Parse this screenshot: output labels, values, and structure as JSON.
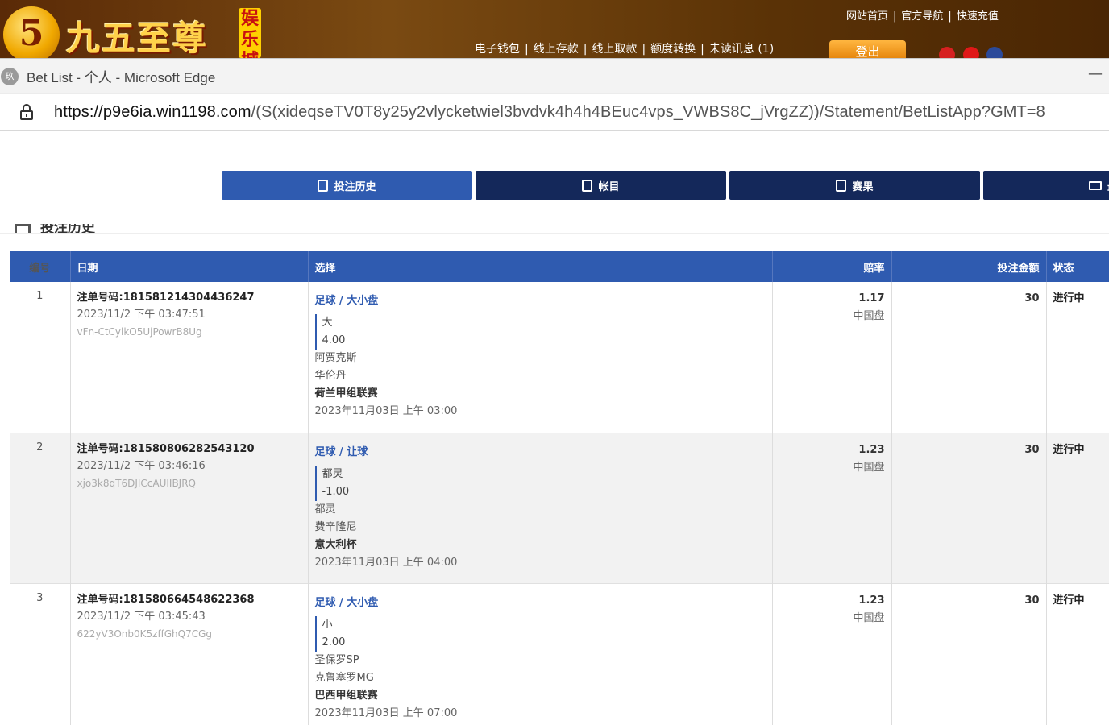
{
  "site": {
    "logo_mark": "5",
    "logo_text": "九五至尊",
    "logo_badge": "娱乐城",
    "top_links": [
      "网站首页",
      "官方导航",
      "快速充值"
    ],
    "nav_links": [
      "电子钱包",
      "线上存款",
      "线上取款",
      "额度转换",
      "未读讯息 (1)"
    ],
    "login_label": "登出"
  },
  "browser": {
    "title": "Bet List - 个人 - Microsoft Edge",
    "url_host": "https://p9e6ia.win1198.com",
    "url_path": "/(S(xideqseTV0T8y25y2vlycketwiel3bvdvk4h4h4BEuc4vps_VWBS8C_jVrgZZ))/Statement/BetListApp?GMT=8",
    "minimize_icon": "minimize-icon"
  },
  "tabs": [
    {
      "label": "投注历史",
      "icon": "receipt-icon",
      "active": true
    },
    {
      "label": "帐目",
      "icon": "ledger-icon",
      "active": false
    },
    {
      "label": "赛果",
      "icon": "results-icon",
      "active": false
    },
    {
      "label": "最新",
      "icon": "envelope-icon",
      "active": false
    }
  ],
  "section_title": "投注历史",
  "table": {
    "headers": {
      "no": "编号",
      "date": "日期",
      "selection": "选择",
      "odds": "赔率",
      "stake": "投注金额",
      "status": "状态"
    },
    "rows": [
      {
        "no": "1",
        "ref": "注单号码:181581214304436247",
        "datetime": "2023/11/2 下午 03:47:51",
        "code": "vFn-CtCylkO5UjPowrB8Ug",
        "sport": "足球 / 大小盘",
        "pick": "大",
        "line": "4.00",
        "home": "阿贾克斯",
        "away": "华伦丹",
        "league": "荷兰甲组联赛",
        "kickoff": "2023年11月03日 上午 03:00",
        "odds": "1.17",
        "odds_type": "中国盘",
        "stake": "30",
        "status": "进行中"
      },
      {
        "no": "2",
        "ref": "注单号码:181580806282543120",
        "datetime": "2023/11/2 下午 03:46:16",
        "code": "xjo3k8qT6DJICcAUIIBJRQ",
        "sport": "足球 / 让球",
        "pick": "都灵",
        "line": "-1.00",
        "home": "都灵",
        "away": "费辛隆尼",
        "league": "意大利杯",
        "kickoff": "2023年11月03日 上午 04:00",
        "odds": "1.23",
        "odds_type": "中国盘",
        "stake": "30",
        "status": "进行中"
      },
      {
        "no": "3",
        "ref": "注单号码:181580664548622368",
        "datetime": "2023/11/2 下午 03:45:43",
        "code": "622yV3Onb0K5zffGhQ7CGg",
        "sport": "足球 / 大小盘",
        "pick": "小",
        "line": "2.00",
        "home": "圣保罗SP",
        "away": "克鲁塞罗MG",
        "league": "巴西甲组联赛",
        "kickoff": "2023年11月03日 上午 07:00",
        "odds": "1.23",
        "odds_type": "中国盘",
        "stake": "30",
        "status": "进行中"
      }
    ]
  },
  "colors": {
    "header_blue": "#2f5bb0",
    "tab_dark": "#14285a",
    "site_brown": "#5a2a07"
  }
}
